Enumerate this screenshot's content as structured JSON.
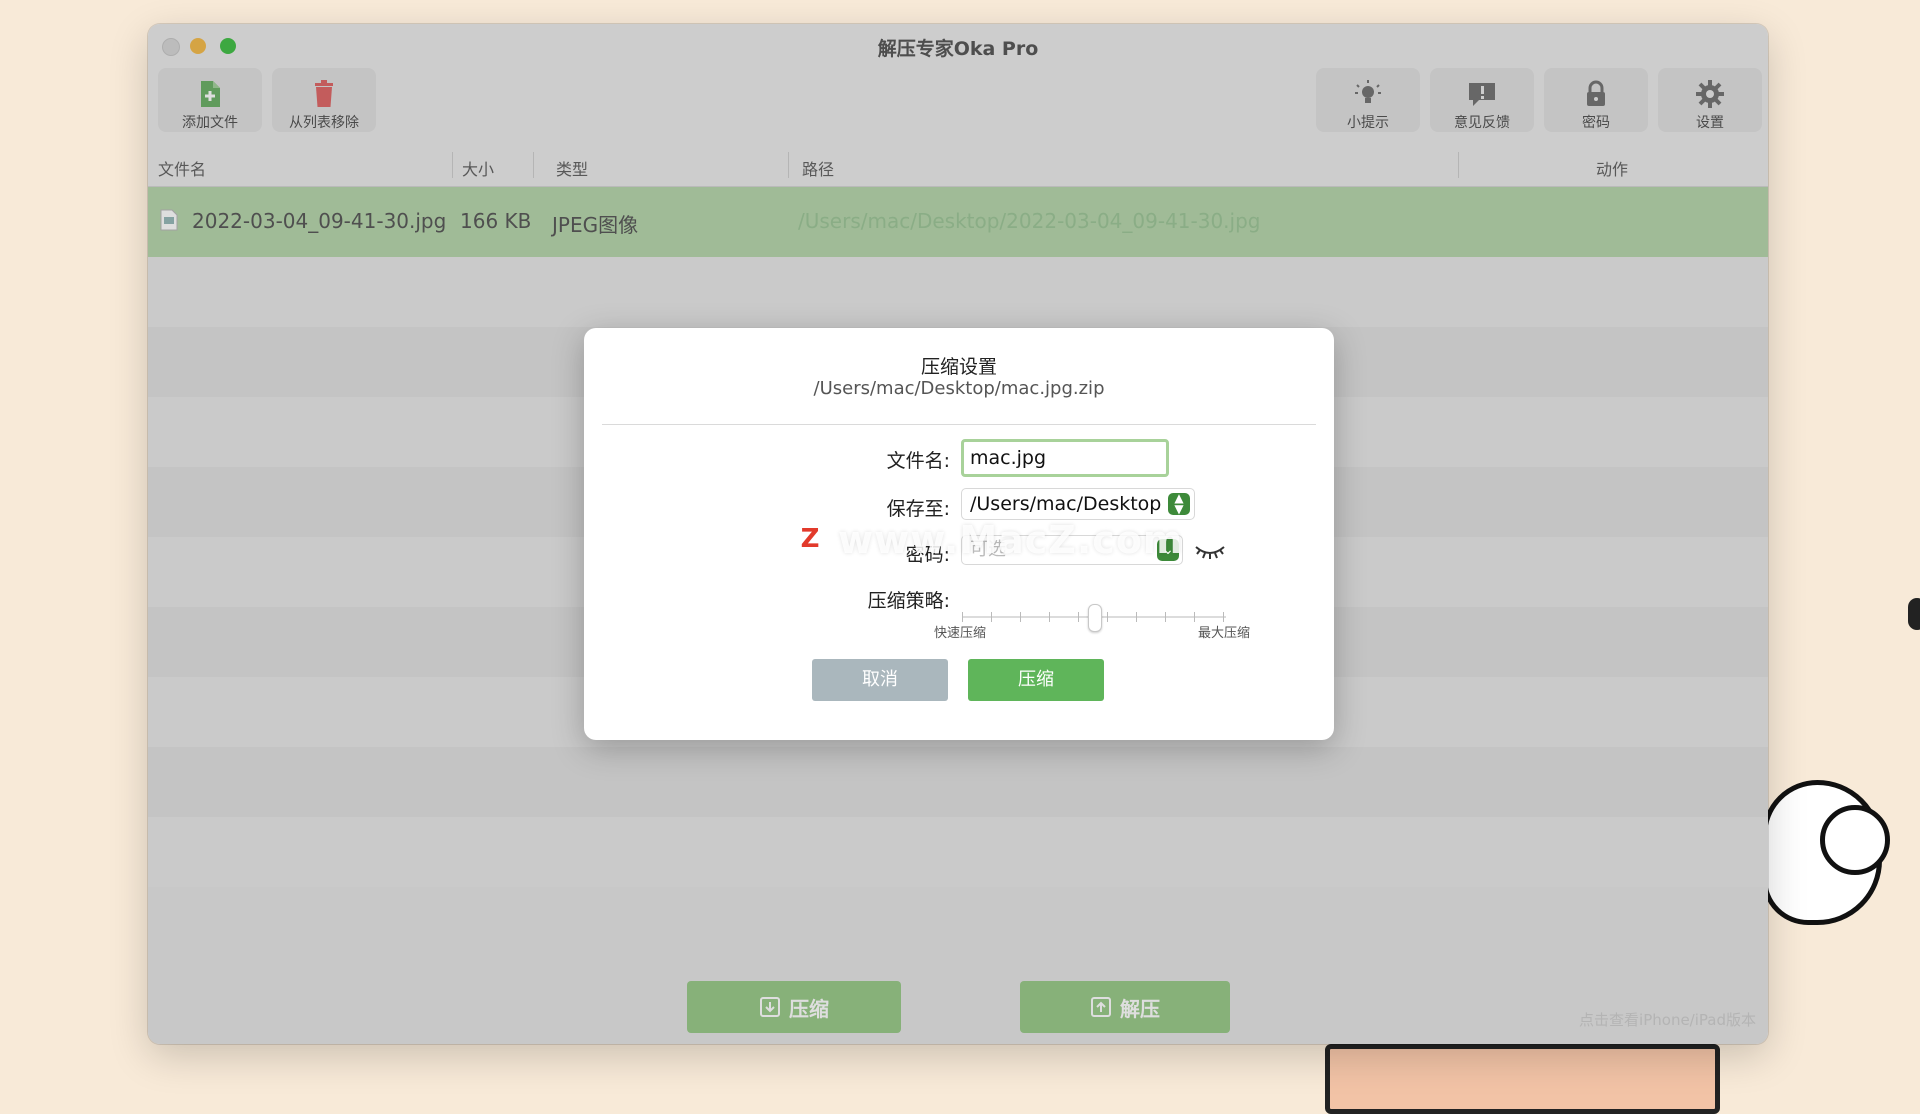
{
  "window": {
    "title": "解压专家Oka Pro"
  },
  "toolbar": {
    "left": [
      {
        "label": "添加文件",
        "icon": "add-file-icon"
      },
      {
        "label": "从列表移除",
        "icon": "trash-icon"
      }
    ],
    "right": [
      {
        "label": "小提示",
        "icon": "lightbulb-icon"
      },
      {
        "label": "意见反馈",
        "icon": "feedback-icon"
      },
      {
        "label": "密码",
        "icon": "lock-icon"
      },
      {
        "label": "设置",
        "icon": "gear-icon"
      }
    ]
  },
  "table": {
    "columns": [
      "文件名",
      "大小",
      "类型",
      "路径",
      "动作"
    ],
    "rows": [
      {
        "name": "2022-03-04_09-41-30.jpg",
        "size": "166 KB",
        "type": "JPEG图像",
        "path": "/Users/mac/Desktop/2022-03-04_09-41-30.jpg"
      }
    ]
  },
  "footer": {
    "compress_label": "压缩",
    "extract_label": "解压",
    "ipad_link": "点击查看iPhone/iPad版本"
  },
  "dialog": {
    "title": "压缩设置",
    "output_path": "/Users/mac/Desktop/mac.jpg.zip",
    "filename_label": "文件名:",
    "filename_value": "mac.jpg",
    "save_label": "保存至:",
    "save_value": "/Users/mac/Desktop",
    "password_label": "密码:",
    "password_placeholder": "可选",
    "strategy_label": "压缩策略:",
    "strategy_min": "快速压缩",
    "strategy_max": "最大压缩",
    "strategy_level": 0.5,
    "cancel_label": "取消",
    "ok_label": "压缩"
  },
  "watermark": {
    "text": "www.MacZ.com",
    "logo": "Z"
  },
  "colors": {
    "accent_green": "#5fb55a",
    "selected_row": "#b8d7ae",
    "cancel_gray": "#aab7bd"
  }
}
